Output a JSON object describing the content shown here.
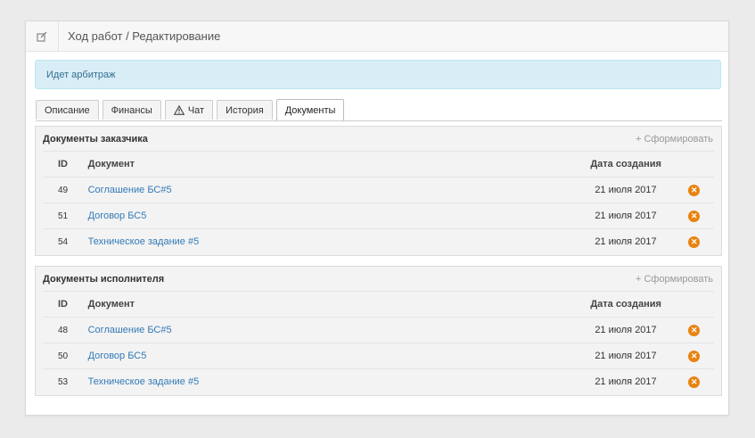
{
  "header": {
    "title": "Ход работ / Редактирование",
    "icon": "edit-icon"
  },
  "alert": {
    "text": "Идет арбитраж"
  },
  "tabs": [
    {
      "label": "Описание",
      "active": false
    },
    {
      "label": "Финансы",
      "active": false
    },
    {
      "label": "Чат",
      "active": false,
      "icon": "warning-icon"
    },
    {
      "label": "История",
      "active": false
    },
    {
      "label": "Документы",
      "active": true
    }
  ],
  "customer_docs": {
    "title": "Документы заказчика",
    "action": "+ Сформировать",
    "columns": {
      "id": "ID",
      "document": "Документ",
      "date": "Дата создания"
    },
    "rows": [
      {
        "id": "49",
        "name": "Соглашение БС#5",
        "date": "21 июля 2017"
      },
      {
        "id": "51",
        "name": "Договор БС5",
        "date": "21 июля 2017"
      },
      {
        "id": "54",
        "name": "Техническое задание #5",
        "date": "21 июля 2017"
      }
    ]
  },
  "contractor_docs": {
    "title": "Документы исполнителя",
    "action": "+ Сформировать",
    "columns": {
      "id": "ID",
      "document": "Документ",
      "date": "Дата создания"
    },
    "rows": [
      {
        "id": "48",
        "name": "Соглашение БС#5",
        "date": "21 июля 2017"
      },
      {
        "id": "50",
        "name": "Договор БС5",
        "date": "21 июля 2017"
      },
      {
        "id": "53",
        "name": "Техническое задание #5",
        "date": "21 июля 2017"
      }
    ]
  },
  "colors": {
    "alert_bg": "#d9edf7",
    "link": "#337ab7",
    "delete": "#e8830f"
  }
}
